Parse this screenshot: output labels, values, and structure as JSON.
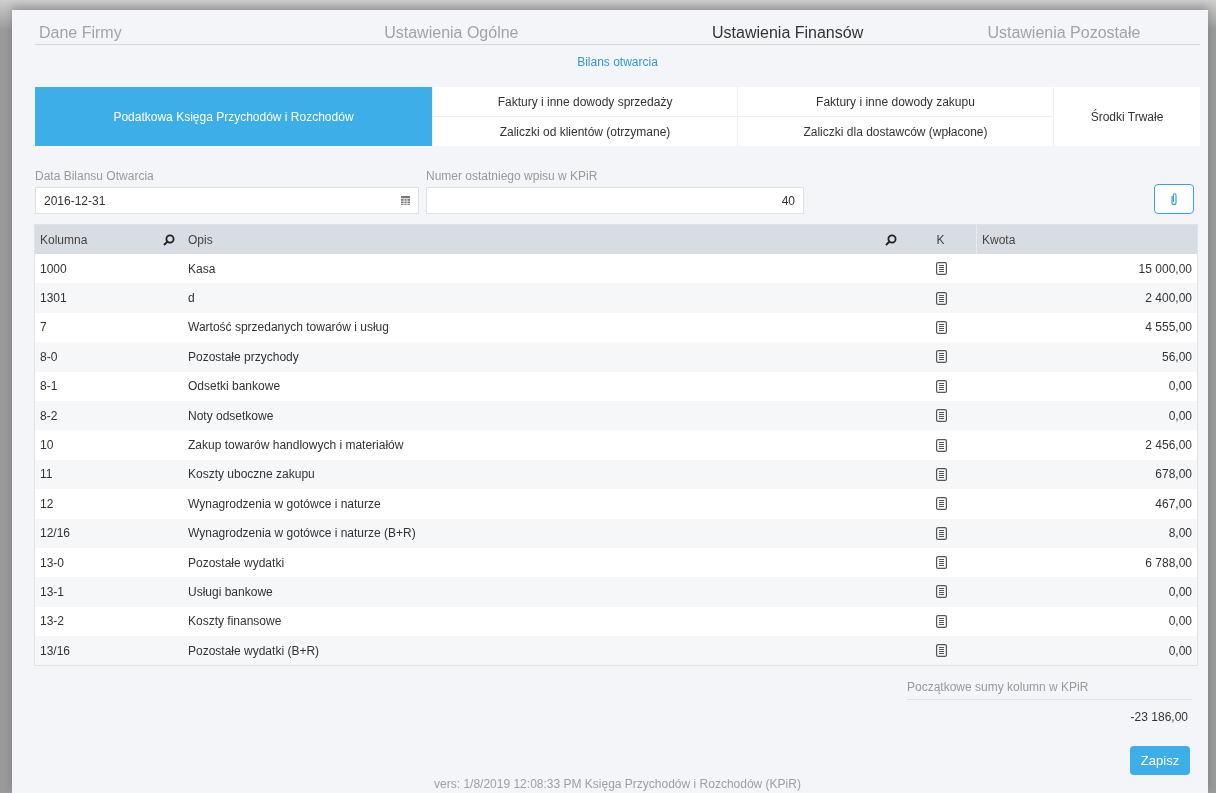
{
  "top_tabs": [
    {
      "label": "Dane Firmy",
      "selected": false
    },
    {
      "label": "Ustawienia Ogólne",
      "selected": false
    },
    {
      "label": "Ustawienia Finansów",
      "selected": true
    },
    {
      "label": "Ustawienia Pozostałe",
      "selected": false
    }
  ],
  "subtab": {
    "label": "Bilans otwarcia"
  },
  "book_tabs": [
    {
      "label": "Podatkowa Księga Przychodów i Rozchodów",
      "selected": true,
      "kind": "tall"
    },
    {
      "label": "Faktury i inne dowody sprzedaży",
      "selected": false,
      "kind": "top"
    },
    {
      "label": "Zaliczki od klientów (otrzymane)",
      "selected": false,
      "kind": "bottom"
    },
    {
      "label": "Faktury i inne dowody zakupu",
      "selected": false,
      "kind": "top"
    },
    {
      "label": "Zaliczki dla dostawców (wpłacone)",
      "selected": false,
      "kind": "bottom"
    },
    {
      "label": "Środki Trwałe",
      "selected": false,
      "kind": "tall"
    }
  ],
  "fields": [
    {
      "label": "Data Bilansu Otwarcia",
      "value": "2016-12-31",
      "kind": "date"
    },
    {
      "label": "Numer ostatniego wpisu w KPiR",
      "value": "40",
      "kind": "number"
    }
  ],
  "table": {
    "columns": [
      {
        "label": "Kolumna",
        "search": true
      },
      {
        "label": "Opis",
        "search": true
      },
      {
        "label": "K",
        "search": false
      },
      {
        "label": "Kwota",
        "search": false
      }
    ],
    "rows": [
      [
        "1000",
        "Kasa",
        "15 000,00"
      ],
      [
        "1301",
        "d",
        "2 400,00"
      ],
      [
        "7",
        "Wartość sprzedanych towarów i usług",
        "4 555,00"
      ],
      [
        "8-0",
        "Pozostałe przychody",
        "56,00"
      ],
      [
        "8-1",
        "Odsetki bankowe",
        "0,00"
      ],
      [
        "8-2",
        "Noty odsetkowe",
        "0,00"
      ],
      [
        "10",
        "Zakup towarów handlowych i materiałów",
        "2 456,00"
      ],
      [
        "11",
        "Koszty uboczne zakupu",
        "678,00"
      ],
      [
        "12",
        "Wynagrodzenia w gotówce i naturze",
        "467,00"
      ],
      [
        "12/16",
        "Wynagrodzenia w gotówce i naturze (B+R)",
        "8,00"
      ],
      [
        "13-0",
        "Pozostałe wydatki",
        "6 788,00"
      ],
      [
        "13-1",
        "Usługi bankowe",
        "0,00"
      ],
      [
        "13-2",
        "Koszty finansowe",
        "0,00"
      ],
      [
        "13/16",
        "Pozostałe wydatki (B+R)",
        "0,00"
      ]
    ]
  },
  "summary": {
    "label": "Początkowe sumy kolumn w KPiR",
    "value": "-23 186,00"
  },
  "save_button": "Zapisz",
  "footer": "vers: 1/8/2019 12:08:33 PM Księga Przychodów i Rozchodów (KPiR)"
}
